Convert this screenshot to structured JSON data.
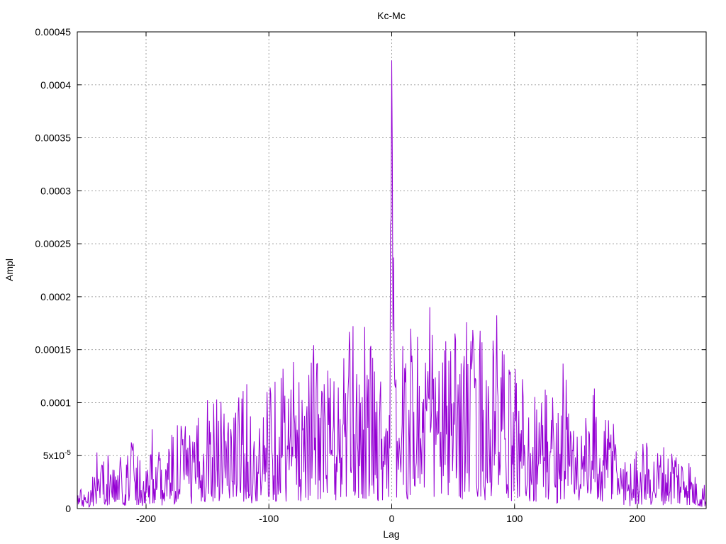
{
  "chart_data": {
    "type": "line",
    "title": "Kc-Mc",
    "xlabel": "Lag",
    "ylabel": "Ampl",
    "xlim": [
      -256,
      256
    ],
    "ylim": [
      0,
      0.00045
    ],
    "grid": true,
    "legend": "none",
    "x_ticks": [
      {
        "value": -200,
        "label": "-200"
      },
      {
        "value": -100,
        "label": "-100"
      },
      {
        "value": 0,
        "label": "0"
      },
      {
        "value": 100,
        "label": "100"
      },
      {
        "value": 200,
        "label": "200"
      }
    ],
    "y_ticks": [
      {
        "value": 0,
        "label": "0"
      },
      {
        "value": 5e-05,
        "label": "5x10",
        "exp": "-5"
      },
      {
        "value": 0.0001,
        "label": "0.0001"
      },
      {
        "value": 0.00015,
        "label": "0.00015"
      },
      {
        "value": 0.0002,
        "label": "0.0002"
      },
      {
        "value": 0.00025,
        "label": "0.00025"
      },
      {
        "value": 0.0003,
        "label": "0.0003"
      },
      {
        "value": 0.00035,
        "label": "0.00035"
      },
      {
        "value": 0.0004,
        "label": "0.0004"
      },
      {
        "value": 0.00045,
        "label": "0.00045"
      }
    ],
    "series_color": "#9400d3",
    "envelope": {
      "x": [
        -256,
        -245,
        -240,
        -235,
        -230,
        -225,
        -220,
        -215,
        -212,
        -205,
        -200,
        -195,
        -190,
        -185,
        -180,
        -175,
        -170,
        -165,
        -160,
        -155,
        -150,
        -145,
        -142,
        -135,
        -130,
        -125,
        -121,
        -115,
        -110,
        -105,
        -98,
        -95,
        -90,
        -85,
        -80,
        -75,
        -70,
        -65,
        -60,
        -55,
        -50,
        -45,
        -40,
        -35,
        -30,
        -25,
        -22,
        -15,
        -10,
        -5,
        -3,
        -1,
        0,
        1,
        2,
        3,
        5,
        10,
        15,
        20,
        25,
        30,
        35,
        40,
        45,
        50,
        55,
        60,
        65,
        70,
        75,
        80,
        85,
        90,
        95,
        100,
        105,
        110,
        115,
        120,
        125,
        130,
        135,
        140,
        145,
        150,
        155,
        160,
        165,
        170,
        175,
        180,
        185,
        190,
        195,
        200,
        205,
        210,
        215,
        220,
        225,
        230,
        235,
        240,
        245,
        250,
        256
      ],
      "peak": [
        1.8e-05,
        2.8e-05,
        6e-05,
        5.5e-05,
        5e-05,
        4.5e-05,
        5e-05,
        5.8e-05,
        8.8e-05,
        5e-05,
        5e-05,
        8.5e-05,
        5.5e-05,
        5e-05,
        7e-05,
        8.5e-05,
        9.5e-05,
        7e-05,
        8e-05,
        9.5e-05,
        0.00013,
        0.00011,
        0.00015,
        0.00011,
        9e-05,
        0.00011,
        0.000135,
        0.0001,
        7e-05,
        9e-05,
        0.000162,
        0.00013,
        0.000155,
        0.00012,
        0.000145,
        0.000125,
        0.000162,
        0.000155,
        0.00016,
        0.000125,
        0.000155,
        0.00011,
        0.000155,
        0.000168,
        0.000175,
        0.000165,
        0.000176,
        0.000155,
        0.000135,
        0.000145,
        0.00015,
        0.000275,
        0.000423,
        0.000333,
        0.00021,
        0.00013,
        0.000165,
        0.000155,
        0.00017,
        0.00019,
        0.000165,
        0.000208,
        0.000165,
        0.00016,
        0.000165,
        0.00017,
        0.000155,
        0.000195,
        0.000165,
        0.000205,
        0.00016,
        0.000135,
        0.000195,
        0.00016,
        0.00013,
        0.000145,
        0.00014,
        0.000115,
        0.000115,
        0.000115,
        0.000125,
        0.000115,
        0.0001,
        0.000163,
        9e-05,
        9e-05,
        0.0001,
        8e-05,
        0.000115,
        8e-05,
        8.5e-05,
        0.00011,
        6e-05,
        5e-05,
        4.5e-05,
        6.5e-05,
        7e-05,
        5.8e-05,
        5.5e-05,
        6.5e-05,
        5.5e-05,
        7e-05,
        5e-05,
        6.5e-05,
        3.5e-05,
        2.8e-05,
        2.5e-05
      ]
    }
  }
}
